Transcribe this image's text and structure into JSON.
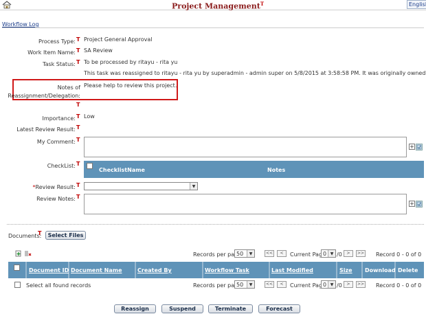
{
  "header": {
    "title": "Project Management",
    "title_marker": "T",
    "language": "English"
  },
  "breadcrumb": {
    "workflow_log": "Workflow Log"
  },
  "marker": "T",
  "form": {
    "process_type": {
      "label": "Process Type:",
      "value": "Project General Approval"
    },
    "work_item_name": {
      "label": "Work Item Name:",
      "value": "SA Review"
    },
    "task_status": {
      "label": "Task Status:",
      "value": "To be processed by ritayu - rita yu",
      "note": "This task was reassigned to ritayu - rita yu by superadmin - admin super on 5/8/2015 at 3:58:58 PM. It was originally owned by superadmin - adm"
    },
    "notes_reassignment": {
      "label_line1": "Notes of",
      "label_line2": "Reassignment/Delegation:",
      "value": "Please help to review this project."
    },
    "importance": {
      "label": "Importance:",
      "value": "Low"
    },
    "latest_review_result": {
      "label": "Latest Review Result:",
      "value": ""
    },
    "my_comment": {
      "label": "My Comment:",
      "value": ""
    },
    "checklist": {
      "label": "CheckList:",
      "col_name": "ChecklistName",
      "col_notes": "Notes"
    },
    "review_result": {
      "required_marker": "*",
      "label": "Review Result:",
      "selected": ""
    },
    "review_notes": {
      "label": "Review Notes:",
      "value": ""
    }
  },
  "documents": {
    "label": "Documents:",
    "select_files": "Select Files",
    "records_per_page_label": "Records per page",
    "records_per_page": "50",
    "current_page_label": "Current Page",
    "current_page": "0",
    "total_pages": "/0",
    "record_summary": "Record 0 - 0 of 0",
    "nav": {
      "first": "<<",
      "prev": "<",
      "next": ">",
      "last": ">>"
    },
    "columns": [
      "Document ID",
      "Document Name",
      "Created By",
      "Workflow Task",
      "Last Modified",
      "Size",
      "Download",
      "Delete"
    ],
    "select_all": "Select all found records"
  },
  "actions": {
    "reassign": "Reassign",
    "suspend": "Suspend",
    "terminate": "Terminate",
    "forecast": "Forecast"
  },
  "colors": {
    "brand_title": "#8a1c1c",
    "table_header": "#5f93b8",
    "highlight_box": "#d01818",
    "marker": "#c00000"
  }
}
